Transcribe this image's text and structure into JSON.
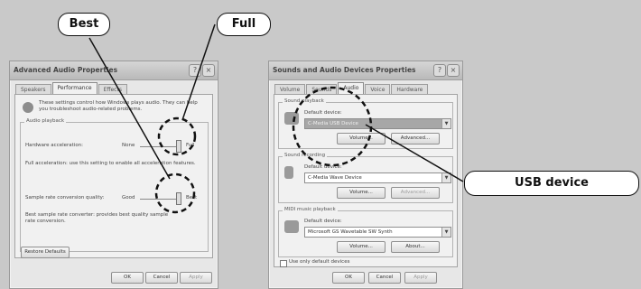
{
  "callouts": {
    "best": "Best",
    "full": "Full",
    "usb_device": "USB device"
  },
  "advanced_dialog": {
    "title": "Advanced Audio Properties",
    "tabs": [
      "Speakers",
      "Performance",
      "Effects"
    ],
    "active_tab": 1,
    "intro": "These settings control how Windows plays audio. They can help you troubleshoot audio-related problems.",
    "group_label": "Audio playback",
    "hw_accel_label": "Hardware acceleration:",
    "hw_accel_min": "None",
    "hw_accel_max": "Full",
    "hw_accel_desc": "Full acceleration: use this setting to enable all acceleration features.",
    "src_quality_label": "Sample rate conversion quality:",
    "src_quality_min": "Good",
    "src_quality_max": "Best",
    "src_quality_desc": "Best sample rate converter: provides best quality sample rate conversion.",
    "restore_defaults": "Restore Defaults",
    "ok": "OK",
    "cancel": "Cancel",
    "apply": "Apply"
  },
  "sounds_dialog": {
    "title": "Sounds and Audio Devices Properties",
    "tabs": [
      "Volume",
      "Sounds",
      "Audio",
      "Voice",
      "Hardware"
    ],
    "active_tab": 2,
    "sound_playback": {
      "label": "Sound playback",
      "default_device_label": "Default device:",
      "device": "C-Media USB Device",
      "volume": "Volume...",
      "advanced": "Advanced..."
    },
    "sound_recording": {
      "label": "Sound recording",
      "default_device_label": "Default device:",
      "device": "C-Media Wave Device",
      "volume": "Volume...",
      "advanced": "Advanced..."
    },
    "midi_playback": {
      "label": "MIDI music playback",
      "default_device_label": "Default device:",
      "device": "Microsoft GS Wavetable SW Synth",
      "volume": "Volume...",
      "about": "About..."
    },
    "use_default_devices": "Use only default devices",
    "ok": "OK",
    "cancel": "Cancel",
    "apply": "Apply"
  }
}
